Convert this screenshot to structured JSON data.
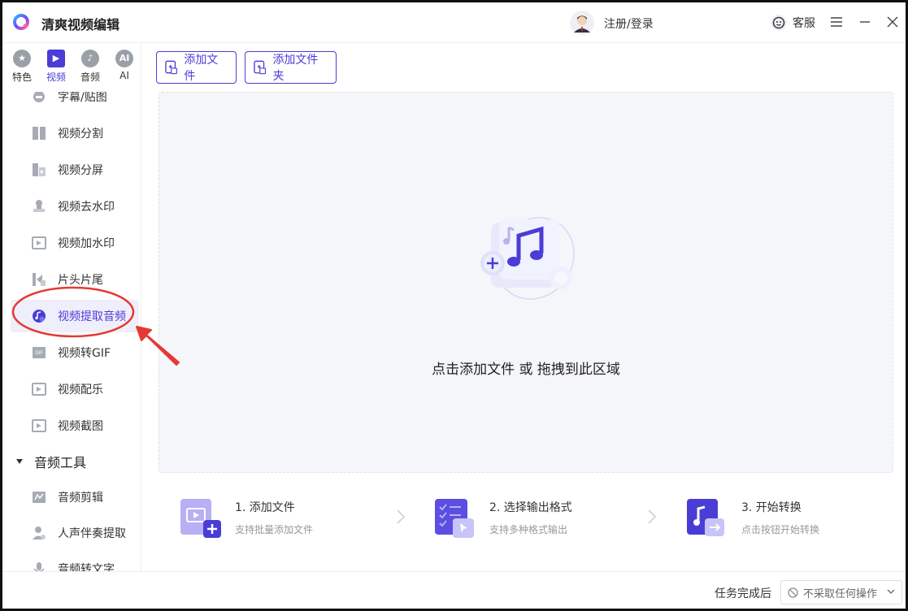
{
  "app": {
    "title": "清爽视频编辑"
  },
  "header": {
    "login_label": "注册/登录",
    "support_label": "客服"
  },
  "categories": [
    {
      "label": "特色",
      "glyph": "★",
      "icon": "star-icon"
    },
    {
      "label": "视频",
      "glyph": "▶",
      "icon": "film-icon"
    },
    {
      "label": "音频",
      "glyph": "♪",
      "icon": "audio-icon"
    },
    {
      "label": "AI",
      "glyph": "AI",
      "icon": "ai-icon"
    }
  ],
  "video_tools": [
    {
      "label": "字幕/贴图",
      "icon": "subtitle-icon"
    },
    {
      "label": "视频分割",
      "icon": "split-icon"
    },
    {
      "label": "视频分屏",
      "icon": "split-screen-icon"
    },
    {
      "label": "视频去水印",
      "icon": "stamp-icon"
    },
    {
      "label": "视频加水印",
      "icon": "watermark-icon"
    },
    {
      "label": "片头片尾",
      "icon": "intro-outro-icon"
    },
    {
      "label": "视频提取音频",
      "icon": "extract-audio-icon"
    },
    {
      "label": "视频转GIF",
      "icon": "gif-icon"
    },
    {
      "label": "视频配乐",
      "icon": "music-icon"
    },
    {
      "label": "视频截图",
      "icon": "screenshot-icon"
    }
  ],
  "audio_section": {
    "title": "音频工具",
    "items": [
      {
        "label": "音频剪辑",
        "icon": "audio-cut-icon"
      },
      {
        "label": "人声伴奏提取",
        "icon": "vocal-icon"
      },
      {
        "label": "音频转文字",
        "icon": "mic-icon"
      }
    ]
  },
  "toolbar": {
    "add_file": "添加文件",
    "add_folder": "添加文件夹"
  },
  "dropzone": {
    "text": "点击添加文件 或 拖拽到此区域"
  },
  "steps": [
    {
      "title": "1. 添加文件",
      "desc": "支持批量添加文件"
    },
    {
      "title": "2. 选择输出格式",
      "desc": "支持多种格式输出"
    },
    {
      "title": "3. 开始转换",
      "desc": "点击按钮开始转换"
    }
  ],
  "footer": {
    "after_label": "任务完成后",
    "selected_option": "不采取任何操作"
  },
  "colors": {
    "accent": "#4a3dd6",
    "annotation": "#e53935"
  }
}
